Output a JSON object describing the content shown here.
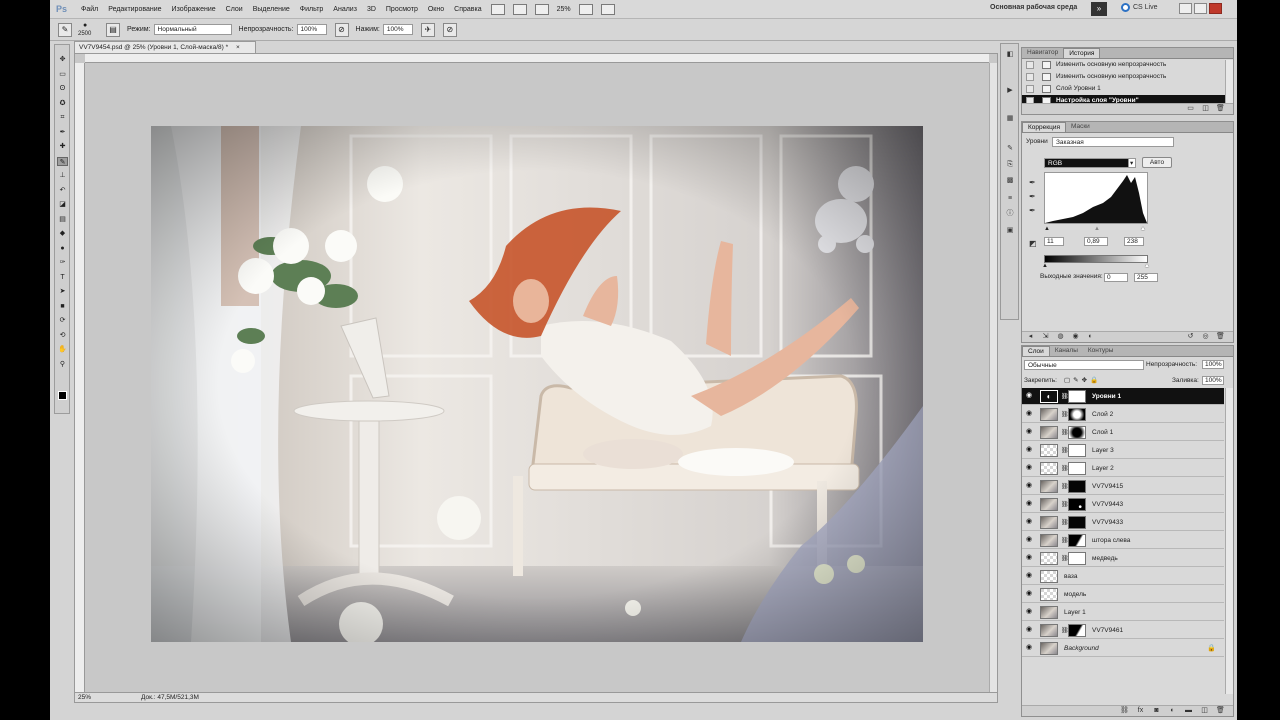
{
  "app": {
    "logo": "Ps"
  },
  "menu": [
    "Файл",
    "Редактирование",
    "Изображение",
    "Слои",
    "Выделение",
    "Фильтр",
    "Анализ",
    "3D",
    "Просмотр",
    "Окно",
    "Справка"
  ],
  "menubar": {
    "zoom": "25%",
    "workspace": "Основная рабочая среда",
    "workspace_more": "»",
    "cslive": "CS Live"
  },
  "options": {
    "brush_size": "2500",
    "mode_label": "Режим:",
    "mode_value": "Нормальный",
    "opacity_label": "Непрозрачность:",
    "opacity_value": "100%",
    "flow_label": "Нажим:",
    "flow_value": "100%"
  },
  "document": {
    "tab_title": "VV7V9454.psd @ 25% (Уровни 1, Слой-маска/8) *",
    "status_zoom": "25%",
    "status_doc": "Док.: 47,5M/521,3M"
  },
  "tools": [
    "move",
    "marquee",
    "lasso",
    "quick-select",
    "crop",
    "eyedropper",
    "healing",
    "brush",
    "stamp",
    "history-brush",
    "eraser",
    "gradient",
    "blur",
    "dodge",
    "pen",
    "type",
    "path-select",
    "shape",
    "3d-rotate",
    "3d-camera",
    "hand",
    "zoom"
  ],
  "history": {
    "tabs": [
      "Навигатор",
      "История"
    ],
    "active_tab": 1,
    "items": [
      {
        "label": "Изменить основную непрозрачность",
        "selected": false
      },
      {
        "label": "Изменить основную непрозрачность",
        "selected": false
      },
      {
        "label": "Слой Уровни 1",
        "selected": false
      },
      {
        "label": "Настройка слоя \"Уровни\"",
        "selected": true
      }
    ]
  },
  "adjustments": {
    "tabs": [
      "Коррекция",
      "Маски"
    ],
    "preset_label": "Уровни",
    "preset_value": "Заказная",
    "channel": "RGB",
    "auto_button": "Авто",
    "input_black": "11",
    "input_gamma": "0,89",
    "input_white": "238",
    "output_label": "Выходные значения:",
    "output_black": "0",
    "output_white": "255"
  },
  "layers": {
    "tabs": [
      "Слои",
      "Каналы",
      "Контуры"
    ],
    "blend_mode": "Обычные",
    "opacity_label": "Непрозрачность:",
    "opacity_value": "100%",
    "lock_label": "Закрепить:",
    "fill_label": "Заливка:",
    "fill_value": "100%",
    "items": [
      {
        "name": "Уровни 1",
        "selected": true,
        "thumb": "adjust",
        "mask": "white"
      },
      {
        "name": "Слой 2",
        "selected": false,
        "thumb": "photo",
        "mask": "vignette"
      },
      {
        "name": "Слой 1",
        "selected": false,
        "thumb": "photo",
        "mask": "vignette-dark"
      },
      {
        "name": "Layer 3",
        "selected": false,
        "thumb": "checker",
        "mask": "white"
      },
      {
        "name": "Layer 2",
        "selected": false,
        "thumb": "checker",
        "mask": "white"
      },
      {
        "name": "VV7V9415",
        "selected": false,
        "thumb": "photo",
        "mask": "black"
      },
      {
        "name": "VV7V9443",
        "selected": false,
        "thumb": "photo",
        "mask": "black-dot"
      },
      {
        "name": "VV7V9433",
        "selected": false,
        "thumb": "photo",
        "mask": "black"
      },
      {
        "name": "штора слева",
        "selected": false,
        "thumb": "photo",
        "mask": "black-white"
      },
      {
        "name": "медведь",
        "selected": false,
        "thumb": "checker",
        "mask": "white"
      },
      {
        "name": "ваза",
        "selected": false,
        "thumb": "checker",
        "mask": "none"
      },
      {
        "name": "модель",
        "selected": false,
        "thumb": "checker",
        "mask": "none"
      },
      {
        "name": "Layer 1",
        "selected": false,
        "thumb": "photo",
        "mask": "none"
      },
      {
        "name": "VV7V9461",
        "selected": false,
        "thumb": "photo",
        "mask": "black-white"
      },
      {
        "name": "Background",
        "selected": false,
        "thumb": "photo",
        "mask": "none",
        "locked": true
      }
    ]
  },
  "colors": {
    "selection": "#111111",
    "panel": "#d9d9d9",
    "workspace_bg": "#c8c8c8",
    "accent": "#2c71c4"
  }
}
